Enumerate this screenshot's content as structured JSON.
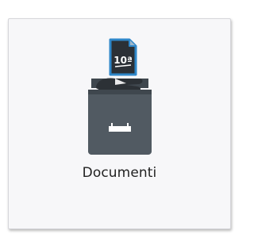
{
  "tile": {
    "label": "Documenti",
    "icon": "document-drawer-icon",
    "badge_text": "10ª",
    "colors": {
      "drawer": "#515a62",
      "drawer_dark": "#3f474e",
      "hand": "#2c3136",
      "hand_cuff": "#ffffff",
      "document": "#2b3036",
      "document_border": "#2f87c9",
      "tile_background": "#f7f7f9",
      "label": "#222222"
    }
  }
}
